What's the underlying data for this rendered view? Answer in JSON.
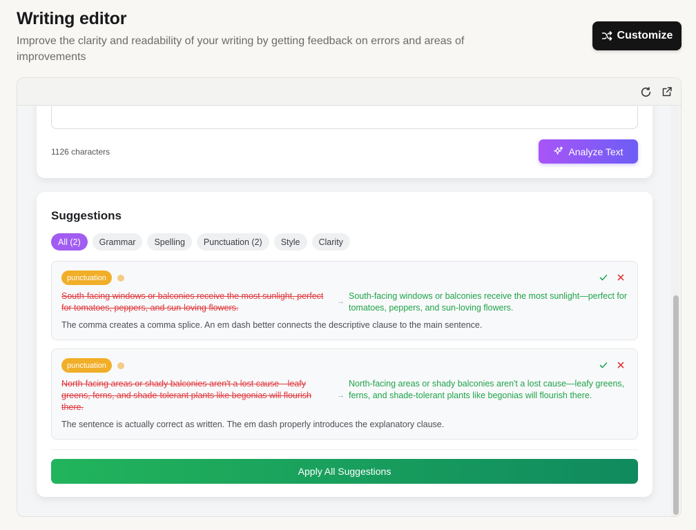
{
  "header": {
    "title": "Writing editor",
    "subtitle": "Improve the clarity and readability of your writing by getting feedback on errors and areas of improvements",
    "customize_label": "Customize"
  },
  "toolbar": {
    "icons": [
      "refresh-icon",
      "external-link-icon"
    ]
  },
  "editor": {
    "char_count": "1126 characters",
    "analyze_label": "Analyze Text"
  },
  "suggestions": {
    "title": "Suggestions",
    "filters": [
      {
        "label": "All (2)",
        "active": true
      },
      {
        "label": "Grammar",
        "active": false
      },
      {
        "label": "Spelling",
        "active": false
      },
      {
        "label": "Punctuation (2)",
        "active": false
      },
      {
        "label": "Style",
        "active": false
      },
      {
        "label": "Clarity",
        "active": false
      }
    ],
    "items": [
      {
        "tag": "punctuation",
        "original": "South-facing windows or balconies receive the most sunlight, perfect for tomatoes, peppers, and sun-loving flowers.",
        "arrow": "→",
        "suggested": "South-facing windows or balconies receive the most sunlight—perfect for tomatoes, peppers, and sun-loving flowers.",
        "explanation": "The comma creates a comma splice. An em dash better connects the descriptive clause to the main sentence."
      },
      {
        "tag": "punctuation",
        "original": "North-facing areas or shady balconies aren't a lost cause—leafy greens, ferns, and shade-tolerant plants like begonias will flourish there.",
        "arrow": "→",
        "suggested": "North-facing areas or shady balconies aren't a lost cause—leafy greens, ferns, and shade-tolerant plants like begonias will flourish there.",
        "explanation": "The sentence is actually correct as written. The em dash properly introduces the explanatory clause."
      }
    ],
    "apply_all_label": "Apply All Suggestions"
  },
  "colors": {
    "accent_purple": "#a15cf2",
    "tag_orange": "#f1ae28",
    "error_red": "#e0393e",
    "success_green": "#1fa34a"
  }
}
